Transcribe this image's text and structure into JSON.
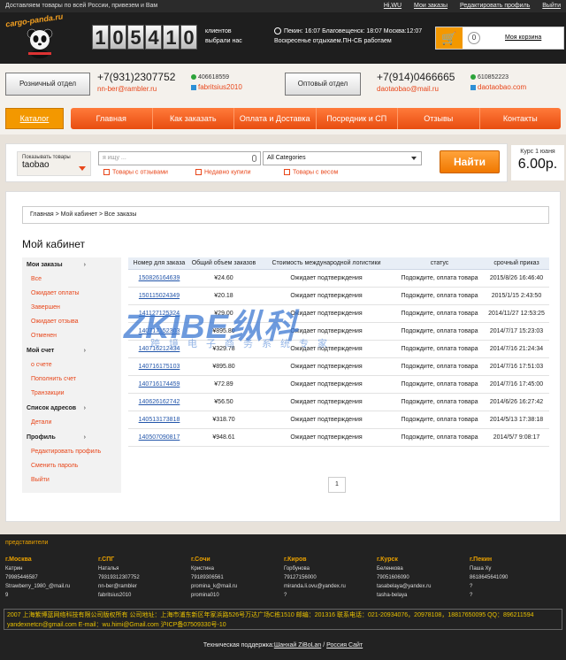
{
  "topbar": {
    "left": "Доставляем товары по всей России, привезем и Вам",
    "links": [
      "Hi,WU",
      "Мои заказы",
      "Редактировать профиль",
      "Выйти"
    ]
  },
  "header": {
    "brand": "cargo-panda.ru",
    "counter": [
      "1",
      "0",
      "5",
      "4",
      "1",
      "0"
    ],
    "clients_line1": "клиентов",
    "clients_line2": "выбрали нас",
    "time_line1": "Пекин: 16:07 Благовещенск: 18:07 Москва:12:07",
    "time_line2": "Воскресенье отдыхаем.ПН-СБ работаем",
    "cart_count": "0",
    "cart_label": "Моя корзина"
  },
  "contacts": {
    "retail": {
      "label": "Розничный отдел",
      "phone": "+7(931)2307752",
      "email": "nn-ber@rambler.ru",
      "qq": "406618559",
      "skype": "fabritsius2010"
    },
    "wholesale": {
      "label": "Оптовый отдел",
      "phone": "+7(914)0466665",
      "email": "daotaobao@mail.ru",
      "qq": "610852223",
      "skype": "daotaobao.com"
    }
  },
  "nav": {
    "catalog": "Каталог",
    "items": [
      "Главная",
      "Как заказать",
      "Оплата и Доставка",
      "Посредник и СП",
      "Отзывы",
      "Контакты"
    ]
  },
  "search": {
    "type_label": "Показывать товары",
    "type_value": "taobao",
    "placeholder": "я ищу ...",
    "category": "All Categories",
    "checks": [
      "Товары с отзывами",
      "Недавно купили",
      "Товары с весом"
    ],
    "button": "Найти"
  },
  "rate": {
    "label": "Курс 1 юаня",
    "value": "6.00р."
  },
  "breadcrumb": "Главная  > Мой кабинет  > Все заказы",
  "page_title": "Мой кабинет",
  "sidebar": [
    {
      "head": "Мои заказы",
      "chev": "›",
      "subs": [
        "Все",
        "Ожидает оплаты",
        "Завершен",
        "Ожидает отзыва",
        "Отменен"
      ]
    },
    {
      "head": "Мой счет",
      "chev": "›",
      "subs": [
        "о счете",
        "Пополнить счет",
        "Транзакции"
      ]
    },
    {
      "head": "Список адресов",
      "chev": "›",
      "subs": [
        "Детали"
      ]
    },
    {
      "head": "Профиль",
      "chev": "›",
      "subs": [
        "Редактировать профиль",
        "Сменить пароль",
        "Выйти"
      ]
    }
  ],
  "table": {
    "headers": [
      "Номер для заказа",
      "Общий объем заказов",
      "Стоимость международной логистики",
      "статус",
      "срочный приказ"
    ],
    "rows": [
      [
        "150826164639",
        "¥24.60",
        "Ожидает подтверждения",
        "Подождите, оплата товара",
        "2015/8/26 16:46:40"
      ],
      [
        "150115024349",
        "¥20.18",
        "Ожидает подтверждения",
        "Подождите, оплата товара",
        "2015/1/15 2:43:50"
      ],
      [
        "141127125324",
        "¥29.00",
        "Ожидает подтверждения",
        "Подождите, оплата товара",
        "2014/11/27 12:53:25"
      ],
      [
        "140717152303",
        "¥895.80",
        "Ожидает подтверждения",
        "Подождите, оплата товара",
        "2014/7/17 15:23:03"
      ],
      [
        "140716212434",
        "¥329.78",
        "Ожидает подтверждения",
        "Подождите, оплата товара",
        "2014/7/16 21:24:34"
      ],
      [
        "140716175103",
        "¥895.80",
        "Ожидает подтверждения",
        "Подождите, оплата товара",
        "2014/7/16 17:51:03"
      ],
      [
        "140716174459",
        "¥72.89",
        "Ожидает подтверждения",
        "Подождите, оплата товара",
        "2014/7/16 17:45:00"
      ],
      [
        "140626162742",
        "¥56.50",
        "Ожидает подтверждения",
        "Подождите, оплата товара",
        "2014/6/26 16:27:42"
      ],
      [
        "140513173818",
        "¥318.70",
        "Ожидает подтверждения",
        "Подождите, оплата товара",
        "2014/5/13 17:38:18"
      ],
      [
        "140507090817",
        "¥948.61",
        "Ожидает подтверждения",
        "Подождите, оплата товара",
        "2014/5/7 9:08:17"
      ]
    ]
  },
  "pager": "1",
  "watermark": {
    "big": "ZKIBE纵科",
    "small": "跨境电子商务系统专家"
  },
  "footer": {
    "title": "представители",
    "cities": [
      {
        "name": "г.Москва",
        "lines": [
          "Катрин",
          "79985446587",
          "Strawberry_1980_@mail.ru",
          "9"
        ]
      },
      {
        "name": "г.СПГ",
        "lines": [
          "Наталья",
          "79319312307752",
          "nn-ber@rambler",
          "fabritsius2010"
        ]
      },
      {
        "name": "г.Сочи",
        "lines": [
          "Кристина",
          "79189306561",
          "promina_k@mail.ru",
          "promina010"
        ]
      },
      {
        "name": "г.Киров",
        "lines": [
          "Горбунова",
          "79127156000",
          "miranda.li.ovu@yandex.ru",
          "?"
        ]
      },
      {
        "name": "г.Курск",
        "lines": [
          "Беленкова",
          "79051606090",
          "tasabelaya@yandex.ru",
          "tasha-belaya"
        ]
      },
      {
        "name": "г.Пекин",
        "lines": [
          "Паша Ху",
          "8618645641090",
          "?",
          "?"
        ]
      }
    ],
    "copyright_1": "2007 上海紫博蓝网络科技有限公司版权所有  公司地址：上海市浦东新区年家浜路526号万达广场C栋1510 邮编：201316 联系电话：021-20934076，20978108，18817650095 QQ：896211594",
    "copyright_2": "yandexnetcn@gmail.com E-mail：wu.himi@Gmail.com 沪ICP备07509330号-10",
    "support_prefix": "Техническая поддержка:",
    "support_link1": "Шанхай ZiBoLan",
    "support_sep": " / ",
    "support_link2": "Россия Сайт"
  }
}
